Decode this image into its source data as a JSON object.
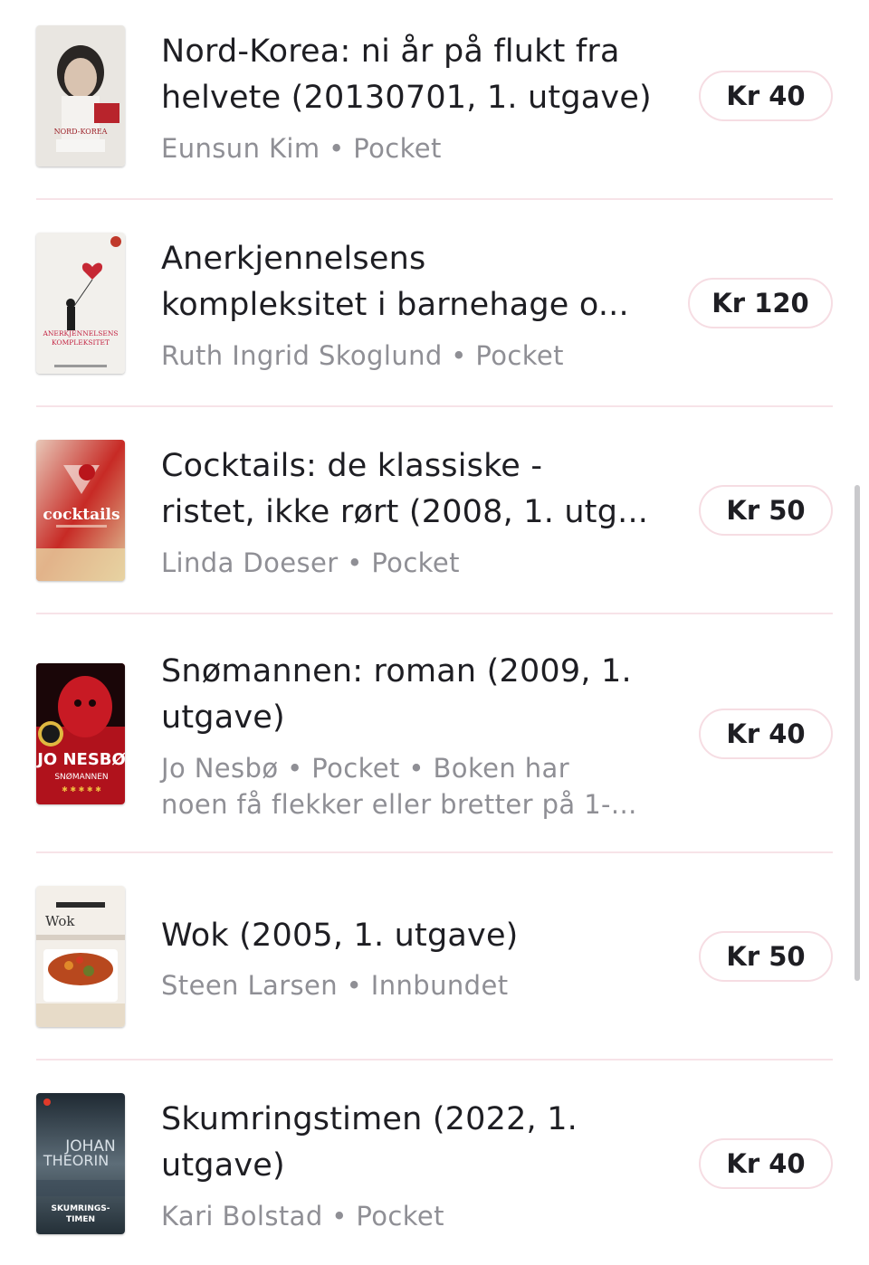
{
  "books": [
    {
      "title_line1": "Nord-Korea: ni år på flukt fra",
      "title_line2": "helvete (20130701, 1. utgave)",
      "meta_line1": "Eunsun Kim • Pocket",
      "meta_line2": "",
      "price": "Kr 40",
      "cover_text": "NORD-KOREA",
      "cover_icon": "book-cover-portrait-girl"
    },
    {
      "title_line1": "Anerkjennelsens",
      "title_line2": "kompleksitet i barnehage o...",
      "meta_line1": "Ruth Ingrid Skoglund • Pocket",
      "meta_line2": "",
      "price": "Kr 120",
      "cover_text": "ANERKJENNELSENS KOMPLEKSITET",
      "cover_icon": "book-cover-balloon-girl"
    },
    {
      "title_line1": "Cocktails: de klassiske -",
      "title_line2": "ristet, ikke rørt (2008, 1. utg...",
      "meta_line1": "Linda Doeser • Pocket",
      "meta_line2": "",
      "price": "Kr 50",
      "cover_text": "cocktails",
      "cover_icon": "book-cover-cocktail-glass"
    },
    {
      "title_line1": "Snømannen: roman (2009, 1.",
      "title_line2": "utgave)",
      "meta_line1": "Jo Nesbø • Pocket • Boken har",
      "meta_line2": "noen få flekker eller bretter på 1-...",
      "price": "Kr 40",
      "cover_text": "JO NESBØ SNØMANNEN",
      "cover_icon": "book-cover-red-snowman"
    },
    {
      "title_line1": "Wok (2005, 1. utgave)",
      "title_line2": "",
      "meta_line1": "Steen Larsen • Innbundet",
      "meta_line2": "",
      "price": "Kr 50",
      "cover_text": "Wok",
      "cover_icon": "book-cover-wok-dish"
    },
    {
      "title_line1": "Skumringstimen (2022, 1.",
      "title_line2": "utgave)",
      "meta_line1": "Kari Bolstad • Pocket",
      "meta_line2": "",
      "price": "Kr 40",
      "cover_text": "JOHAN THEORIN SKUMRINGS-TIMEN",
      "cover_icon": "book-cover-dusk-sea"
    }
  ],
  "colors": {
    "divider": "#f7e3e8",
    "price_border": "#f6dde3",
    "meta_text": "#8f8f95",
    "title_text": "#1e1e23"
  }
}
